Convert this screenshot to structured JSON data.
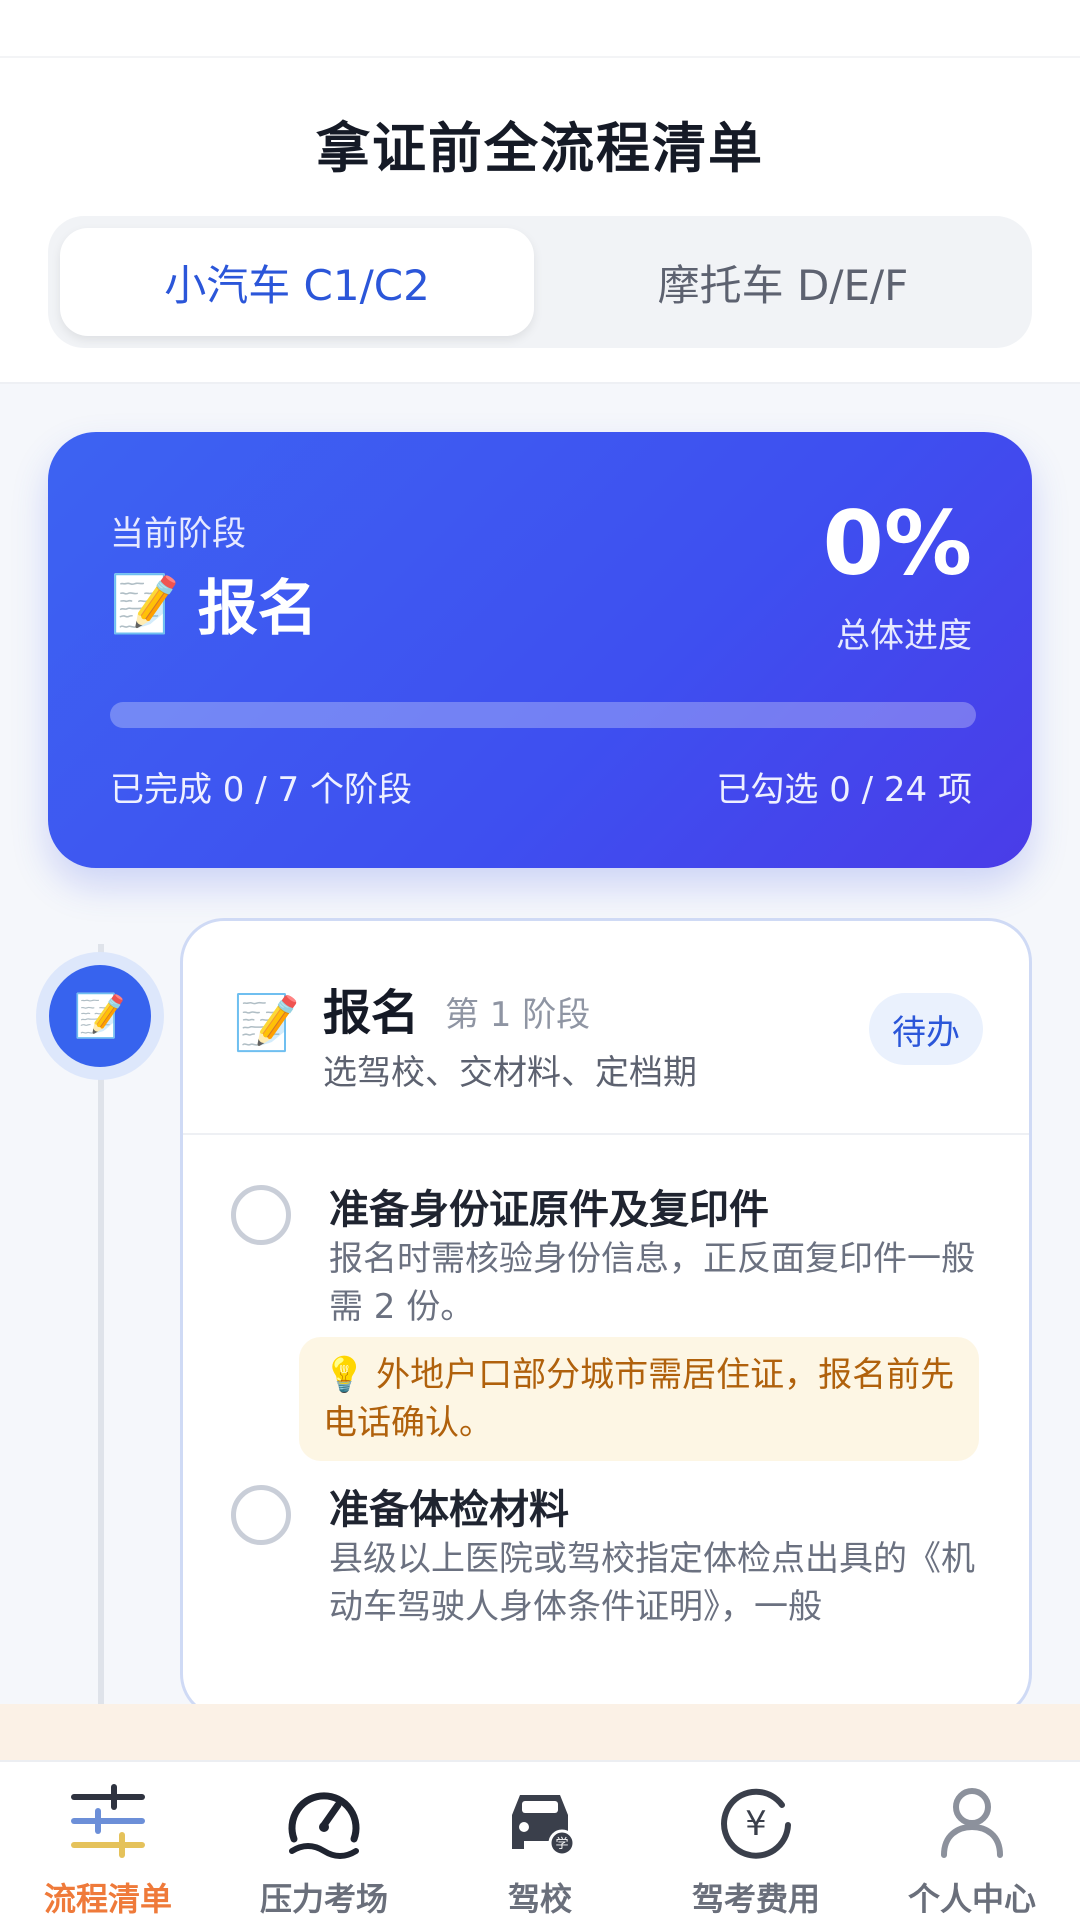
{
  "header": {
    "title": "拿证前全流程清单",
    "segments": [
      {
        "label": "小汽车 C1/C2",
        "active": true
      },
      {
        "label": "摩托车 D/E/F",
        "active": false
      }
    ]
  },
  "progress": {
    "stage_label": "当前阶段",
    "stage_icon": "memo-icon",
    "stage_icon_glyph": "📝",
    "stage_name": "报名",
    "percent_text": "0%",
    "percent_value": 0,
    "percent_label": "总体进度",
    "stages_done_text": "已完成 0 / 7 个阶段",
    "items_done_text": "已勾选 0 / 24 项"
  },
  "stage": {
    "icon": "memo-icon",
    "icon_glyph": "📝",
    "title": "报名",
    "subtitle": "第 1 阶段",
    "description": "选驾校、交材料、定档期",
    "badge": "待办",
    "tasks": [
      {
        "title": "准备身份证原件及复印件",
        "description": "报名时需核验身份信息，正反面复印件一般需 2 份。",
        "tip": "💡 外地户口部分城市需居住证，报名前先电话确认。",
        "checked": false
      },
      {
        "title": "准备体检材料",
        "description": "县级以上医院或驾校指定体检点出具的《机动车驾驶人身体条件证明》，一般",
        "checked": false
      }
    ]
  },
  "tabbar": {
    "items": [
      {
        "label": "流程清单",
        "icon": "checklist-sliders-icon",
        "active": true
      },
      {
        "label": "压力考场",
        "icon": "speedometer-icon",
        "active": false
      },
      {
        "label": "驾校",
        "icon": "car-school-icon",
        "active": false
      },
      {
        "label": "驾考费用",
        "icon": "yuan-coin-icon",
        "active": false
      },
      {
        "label": "个人中心",
        "icon": "user-icon",
        "active": false
      }
    ]
  },
  "colors": {
    "primary": "#2b56d9",
    "accent_orange": "#ef7a3a",
    "card_gradient_start": "#3d63f2",
    "card_gradient_end": "#4a3ce8",
    "tip_bg": "#fdf6e4",
    "tip_text": "#b0610c"
  }
}
